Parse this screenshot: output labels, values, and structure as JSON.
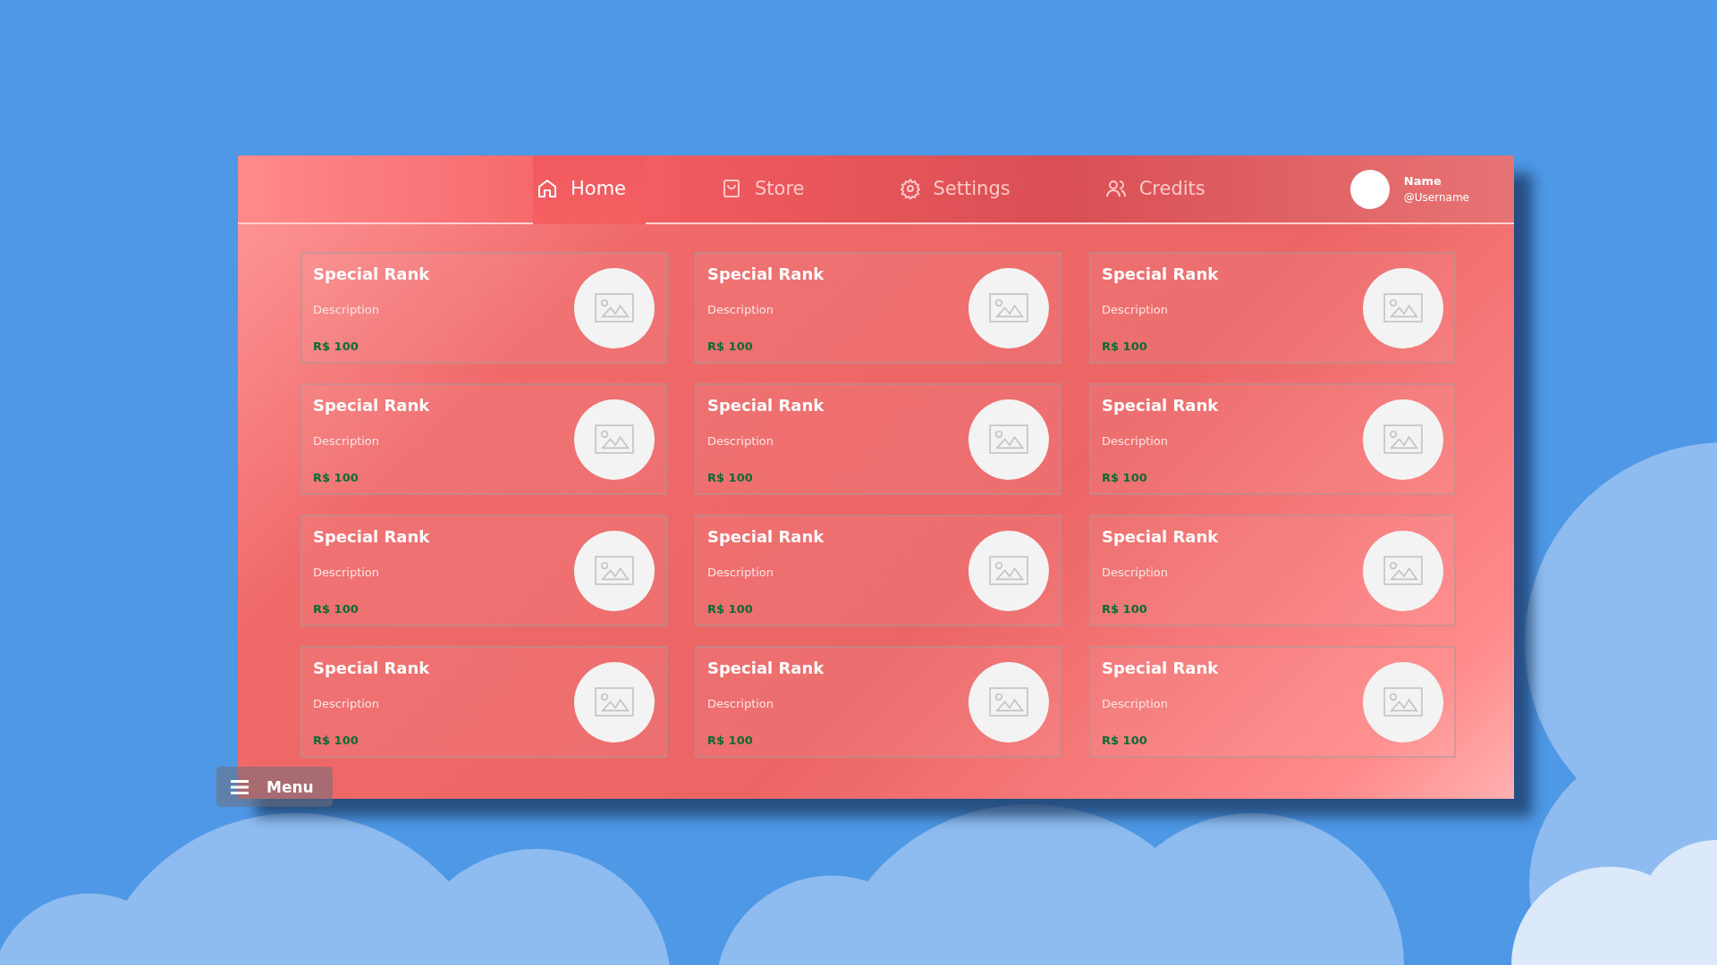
{
  "nav": {
    "tabs": [
      {
        "label": "Home",
        "selected": true
      },
      {
        "label": "Store",
        "selected": false
      },
      {
        "label": "Settings",
        "selected": false
      },
      {
        "label": "Credits",
        "selected": false
      }
    ]
  },
  "user": {
    "name": "Name",
    "username": "@Username"
  },
  "cards": [
    {
      "title": "Special Rank",
      "description": "Description",
      "price": "R$ 100"
    },
    {
      "title": "Special Rank",
      "description": "Description",
      "price": "R$ 100"
    },
    {
      "title": "Special Rank",
      "description": "Description",
      "price": "R$ 100"
    },
    {
      "title": "Special Rank",
      "description": "Description",
      "price": "R$ 100"
    },
    {
      "title": "Special Rank",
      "description": "Description",
      "price": "R$ 100"
    },
    {
      "title": "Special Rank",
      "description": "Description",
      "price": "R$ 100"
    },
    {
      "title": "Special Rank",
      "description": "Description",
      "price": "R$ 100"
    },
    {
      "title": "Special Rank",
      "description": "Description",
      "price": "R$ 100"
    },
    {
      "title": "Special Rank",
      "description": "Description",
      "price": "R$ 100"
    },
    {
      "title": "Special Rank",
      "description": "Description",
      "price": "R$ 100"
    },
    {
      "title": "Special Rank",
      "description": "Description",
      "price": "R$ 100"
    },
    {
      "title": "Special Rank",
      "description": "Description",
      "price": "R$ 100"
    }
  ],
  "menu_button": {
    "label": "Menu"
  }
}
